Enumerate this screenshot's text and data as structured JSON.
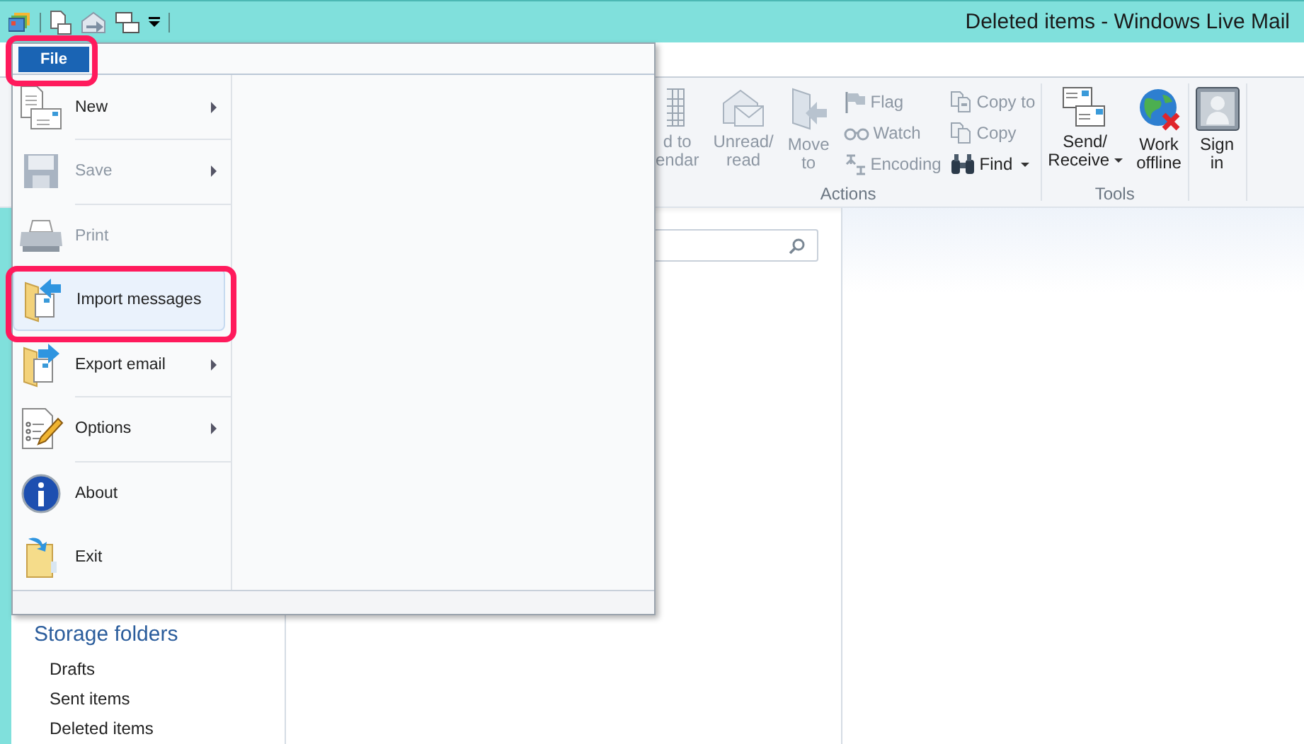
{
  "window": {
    "title": "Deleted items - Windows Live Mail"
  },
  "ribbon": {
    "groups": [
      {
        "label": "Actions",
        "large": [
          {
            "label": "d to\nendar",
            "disabled": true
          },
          {
            "label": "Unread/\nread",
            "disabled": true
          },
          {
            "label": "Move\nto",
            "disabled": true
          }
        ],
        "small": [
          {
            "label": "Flag",
            "disabled": true
          },
          {
            "label": "Watch",
            "disabled": true
          },
          {
            "label": "Encoding",
            "disabled": true
          },
          {
            "label": "Copy to",
            "disabled": true
          },
          {
            "label": "Copy",
            "disabled": true
          },
          {
            "label": "Find",
            "disabled": false,
            "dropdown": true
          }
        ]
      },
      {
        "label": "Tools",
        "large": [
          {
            "label": "Send/\nReceive",
            "disabled": false,
            "dropdown": true
          },
          {
            "label": "Work\noffline",
            "disabled": false
          }
        ]
      },
      {
        "large": [
          {
            "label": "Sign\nin",
            "disabled": false
          }
        ]
      }
    ]
  },
  "sidebar": {
    "header": "Storage folders",
    "items": [
      "Drafts",
      "Sent items",
      "Deleted items"
    ]
  },
  "file_menu": {
    "button": "File",
    "items": [
      {
        "label": "New",
        "disabled": false,
        "selected": false,
        "submenu": true,
        "divider_above": false
      },
      {
        "label": "Save",
        "disabled": true,
        "selected": false,
        "submenu": true,
        "divider_above": true
      },
      {
        "label": "Print",
        "disabled": true,
        "selected": false,
        "submenu": false,
        "divider_above": true
      },
      {
        "label": "Import messages",
        "disabled": false,
        "selected": true,
        "submenu": false,
        "divider_above": false
      },
      {
        "label": "Export email",
        "disabled": false,
        "selected": false,
        "submenu": true,
        "divider_above": false
      },
      {
        "label": "Options",
        "disabled": false,
        "selected": false,
        "submenu": true,
        "divider_above": true
      },
      {
        "label": "About",
        "disabled": false,
        "selected": false,
        "submenu": false,
        "divider_above": true
      },
      {
        "label": "Exit",
        "disabled": false,
        "selected": false,
        "submenu": false,
        "divider_above": false
      }
    ]
  }
}
